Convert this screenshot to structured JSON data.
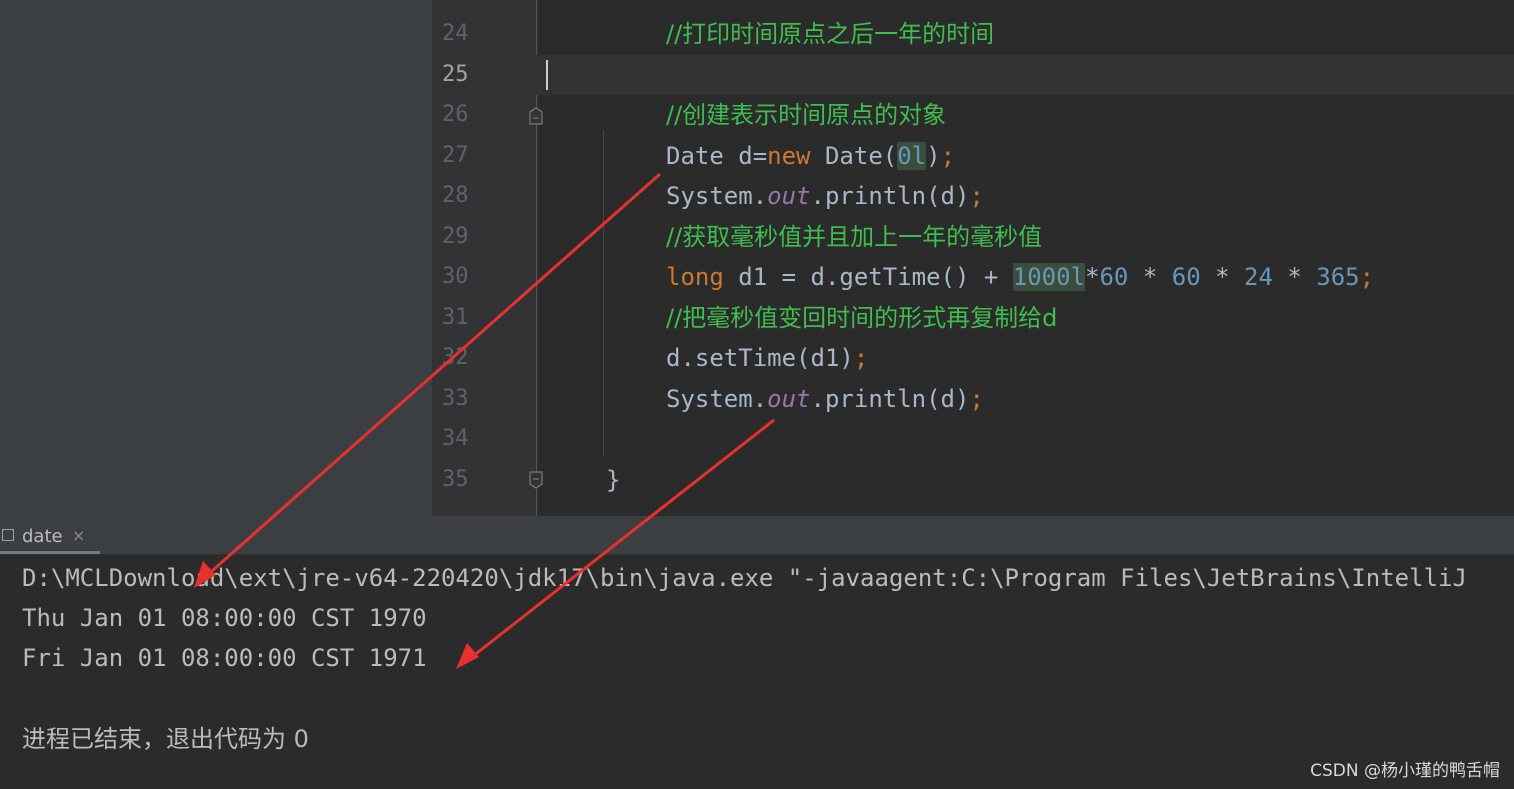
{
  "editor": {
    "lines": [
      {
        "num": "24",
        "comment": "//打印时间原点之后一年的时间"
      },
      {
        "num": "25"
      },
      {
        "num": "26",
        "comment": "//创建表示时间原点的对象"
      },
      {
        "num": "27",
        "t1": "Date d=",
        "kw": "new",
        "t2": " Date(",
        "num_lit": "0l",
        "t3": ")",
        "semi": ";"
      },
      {
        "num": "28",
        "t1": "System.",
        "field": "out",
        "t2": ".println(d)",
        "semi": ";"
      },
      {
        "num": "29",
        "comment": "//获取毫秒值并且加上一年的毫秒值"
      },
      {
        "num": "30",
        "kw": "long",
        "t1": " d1 = d.getTime() + ",
        "num1": "1000l",
        "t2": "*",
        "num2": "60",
        "t3": " * ",
        "num3": "60",
        "t4": " * ",
        "num4": "24",
        "t5": " * ",
        "num5": "365",
        "semi": ";"
      },
      {
        "num": "31",
        "comment": "//把毫秒值变回时间的形式再复制给d"
      },
      {
        "num": "32",
        "t1": "d.setTime(d1)",
        "semi": ";"
      },
      {
        "num": "33",
        "t1": "System.",
        "field": "out",
        "t2": ".println(d)",
        "semi": ";"
      },
      {
        "num": "34"
      },
      {
        "num": "35",
        "t1": "}"
      }
    ]
  },
  "console": {
    "tab_label": "date",
    "tab_close": "×",
    "lines": [
      "D:\\MCLDownload\\ext\\jre-v64-220420\\jdk17\\bin\\java.exe \"-javaagent:C:\\Program Files\\JetBrains\\IntelliJ",
      "Thu Jan 01 08:00:00 CST 1970",
      "Fri Jan 01 08:00:00 CST 1971",
      "进程已结束，退出代码为 0"
    ]
  },
  "watermark": "CSDN @杨小瑾的鸭舌帽",
  "colors": {
    "comment": "#3fbd4e",
    "keyword": "#cc7832",
    "number": "#6897bb",
    "field": "#9876aa",
    "arrow": "#e8312f"
  }
}
